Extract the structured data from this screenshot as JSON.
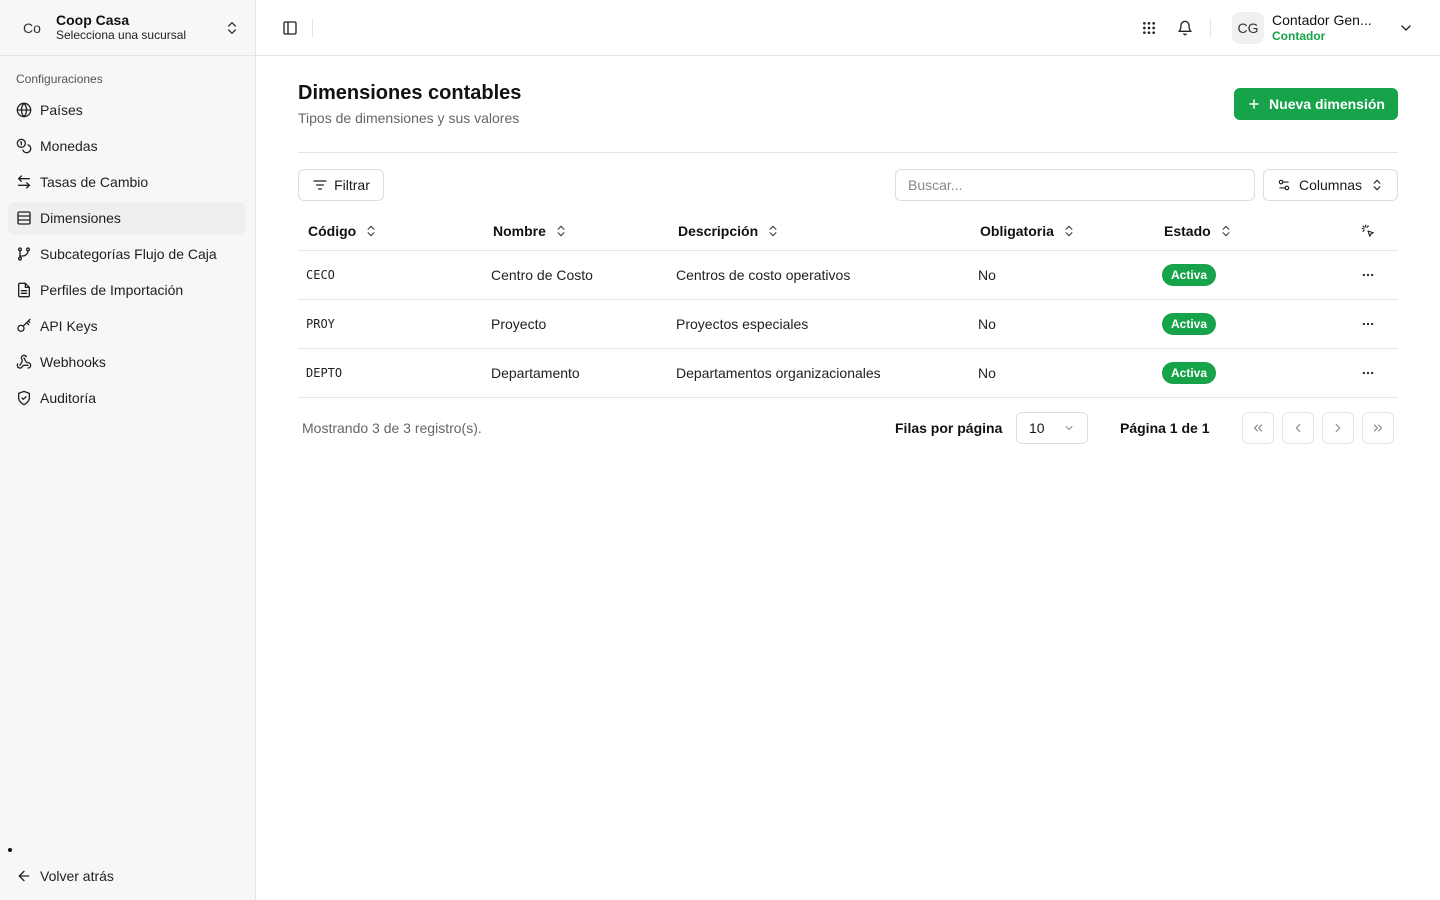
{
  "sidebar": {
    "org": {
      "avatar": "Co",
      "name": "Coop Casa",
      "subtitle": "Selecciona una sucursal"
    },
    "group_label": "Configuraciones",
    "items": [
      {
        "label": "Países",
        "icon": "globe-icon",
        "active": false
      },
      {
        "label": "Monedas",
        "icon": "coins-icon",
        "active": false
      },
      {
        "label": "Tasas de Cambio",
        "icon": "arrows-exchange-icon",
        "active": false
      },
      {
        "label": "Dimensiones",
        "icon": "table-icon",
        "active": true
      },
      {
        "label": "Subcategorías Flujo de Caja",
        "icon": "git-branch-icon",
        "active": false
      },
      {
        "label": "Perfiles de Importación",
        "icon": "file-text-icon",
        "active": false
      },
      {
        "label": "API Keys",
        "icon": "key-icon",
        "active": false
      },
      {
        "label": "Webhooks",
        "icon": "webhook-icon",
        "active": false
      },
      {
        "label": "Auditoría",
        "icon": "shield-icon",
        "active": false
      }
    ],
    "back_label": "Volver atrás"
  },
  "header": {
    "user": {
      "avatar": "CG",
      "name": "Contador Gen...",
      "role": "Contador"
    }
  },
  "page": {
    "title": "Dimensiones contables",
    "subtitle": "Tipos de dimensiones y sus valores",
    "new_button": "Nueva dimensión"
  },
  "toolbar": {
    "filter_label": "Filtrar",
    "search_placeholder": "Buscar...",
    "columns_label": "Columnas"
  },
  "table": {
    "columns": [
      "Código",
      "Nombre",
      "Descripción",
      "Obligatoria",
      "Estado"
    ],
    "rows": [
      {
        "codigo": "CECO",
        "nombre": "Centro de Costo",
        "descripcion": "Centros de costo operativos",
        "obligatoria": "No",
        "estado": "Activa"
      },
      {
        "codigo": "PROY",
        "nombre": "Proyecto",
        "descripcion": "Proyectos especiales",
        "obligatoria": "No",
        "estado": "Activa"
      },
      {
        "codigo": "DEPTO",
        "nombre": "Departamento",
        "descripcion": "Departamentos organizacionales",
        "obligatoria": "No",
        "estado": "Activa"
      }
    ]
  },
  "footer": {
    "showing": "Mostrando 3 de 3 registro(s).",
    "rows_per_page_label": "Filas por página",
    "rows_per_page_value": "10",
    "page_info": "Página 1 de 1"
  },
  "colors": {
    "accent": "#16a34a",
    "border": "#e4e4e4",
    "sidebar_bg": "#f7f7f7"
  }
}
